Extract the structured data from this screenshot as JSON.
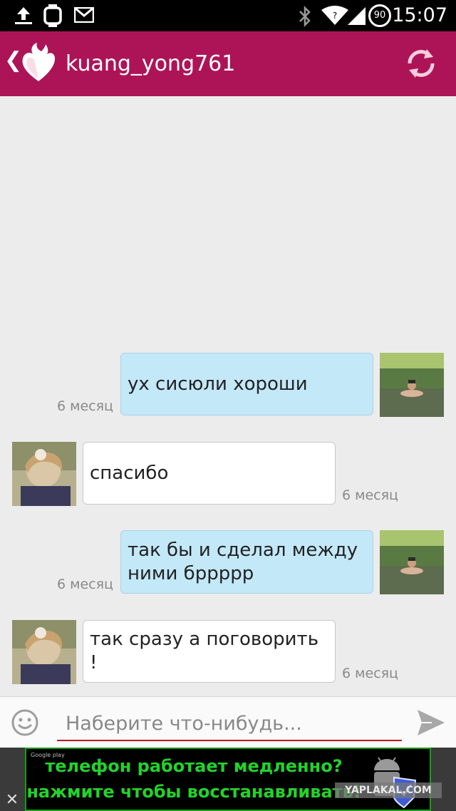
{
  "status_bar": {
    "time": "15:07",
    "battery_level": "90",
    "icons": [
      "upload-icon",
      "watch-icon",
      "gmail-icon",
      "bluetooth-icon",
      "wifi-icon",
      "signal-icon",
      "battery-icon"
    ]
  },
  "app_bar": {
    "title": "kuang_yong761",
    "back_icon": "chevron-left-icon",
    "logo_icon": "flame-heart-logo",
    "refresh_icon": "refresh-icon",
    "color": "#ad1457"
  },
  "messages": [
    {
      "direction": "out",
      "text": "ух сисюли хороши",
      "time": "6 месяц"
    },
    {
      "direction": "in",
      "text": "спасибо",
      "time": "6 месяц"
    },
    {
      "direction": "out",
      "text": "так бы и сделал между ними бррррр",
      "time": "6 месяц"
    },
    {
      "direction": "in",
      "text": "так сразу а поговорить !",
      "time": "6 месяц"
    }
  ],
  "composer": {
    "placeholder": "Наберите что-нибудь...",
    "emoji_icon": "emoji-icon",
    "send_icon": "send-icon"
  },
  "ad": {
    "line1": "телефон работает медленно?",
    "line2": "нажмите чтобы восстанавливать!",
    "store_label": "Google play",
    "close_label": "✕",
    "watermark": "YAPLAKAL.COM"
  },
  "colors": {
    "accent": "#ad1457",
    "bubble_out": "#c3e8f8",
    "bubble_in": "#ffffff",
    "ad_text": "#22d32a"
  }
}
